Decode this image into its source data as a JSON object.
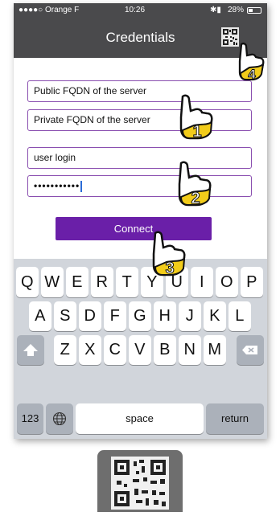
{
  "status_bar": {
    "carrier": "●●●●○ Orange F",
    "time": "10:26",
    "battery": "28%"
  },
  "nav": {
    "title": "Credentials",
    "qr_icon": "qr-code-icon"
  },
  "form": {
    "public_fqdn": "Public FQDN of the server",
    "private_fqdn": "Private FQDN of the server",
    "user_login": "user login",
    "password_mask": "•••••••••••"
  },
  "connect_label": "Connect",
  "keyboard": {
    "row1": [
      "Q",
      "W",
      "E",
      "R",
      "T",
      "Y",
      "U",
      "I",
      "O",
      "P"
    ],
    "row2": [
      "A",
      "S",
      "D",
      "F",
      "G",
      "H",
      "J",
      "K",
      "L"
    ],
    "row3": [
      "Z",
      "X",
      "C",
      "V",
      "B",
      "N",
      "M"
    ],
    "shift_icon": "shift-icon",
    "backspace_icon": "backspace-icon",
    "numbers_label": "123",
    "globe_icon": "globe-icon",
    "space_label": "space",
    "return_label": "return"
  },
  "callouts": [
    "1",
    "2",
    "3",
    "4"
  ],
  "colors": {
    "accent": "#6a1fa8",
    "nav_bg": "#4a4a4c",
    "callout": "#f2cc1a",
    "field_border": "#8a4fb0"
  }
}
